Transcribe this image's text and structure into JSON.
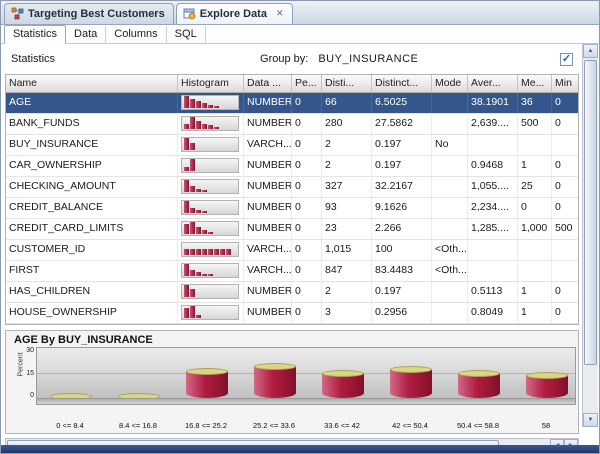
{
  "icons": {
    "check": "✓",
    "up": "▲",
    "down": "▼",
    "left": "◀",
    "right": "▶",
    "close": "✕"
  },
  "window_tabs": {
    "items": [
      {
        "label": "Targeting Best Customers",
        "active": false
      },
      {
        "label": "Explore Data",
        "active": true
      }
    ]
  },
  "subtabs": {
    "items": [
      "Statistics",
      "Data",
      "Columns",
      "SQL"
    ],
    "active": "Statistics"
  },
  "statistics_panel": {
    "title": "Statistics",
    "group_by_label": "Group by:",
    "group_by_value": "BUY_INSURANCE",
    "filter_checkbox_checked": true
  },
  "table": {
    "columns": [
      "Name",
      "Histogram",
      "Data ...",
      "Pe...",
      "Disti...",
      "Distinct...",
      "Mode",
      "Aver...",
      "Me...",
      "Min"
    ],
    "rows": [
      {
        "name": "AGE",
        "selected": true,
        "histogram": [
          1,
          0.75,
          0.55,
          0.4,
          0.28,
          0.18
        ],
        "data_type": "NUMBER",
        "percent_null": "0",
        "distinct_count": "66",
        "distinct_pct": "6.5025",
        "mode": "",
        "average": "38.1901",
        "median": "36",
        "min": "0"
      },
      {
        "name": "BANK_FUNDS",
        "selected": false,
        "histogram": [
          0.45,
          1,
          0.65,
          0.45,
          0.3,
          0.2
        ],
        "data_type": "NUMBER",
        "percent_null": "0",
        "distinct_count": "280",
        "distinct_pct": "27.5862",
        "mode": "",
        "average": "2,639....",
        "median": "500",
        "min": "0"
      },
      {
        "name": "BUY_INSURANCE",
        "selected": false,
        "histogram": [
          1,
          0.6
        ],
        "data_type": "VARCH...",
        "percent_null": "0",
        "distinct_count": "2",
        "distinct_pct": "0.197",
        "mode": "No",
        "average": "",
        "median": "",
        "min": ""
      },
      {
        "name": "CAR_OWNERSHIP",
        "selected": false,
        "histogram": [
          0.35,
          1
        ],
        "data_type": "NUMBER",
        "percent_null": "0",
        "distinct_count": "2",
        "distinct_pct": "0.197",
        "mode": "",
        "average": "0.9468",
        "median": "1",
        "min": "0"
      },
      {
        "name": "CHECKING_AMOUNT",
        "selected": false,
        "histogram": [
          1,
          0.5,
          0.28,
          0.16
        ],
        "data_type": "NUMBER",
        "percent_null": "0",
        "distinct_count": "327",
        "distinct_pct": "32.2167",
        "mode": "",
        "average": "1,055....",
        "median": "25",
        "min": "0"
      },
      {
        "name": "CREDIT_BALANCE",
        "selected": false,
        "histogram": [
          1,
          0.45,
          0.22,
          0.12
        ],
        "data_type": "NUMBER",
        "percent_null": "0",
        "distinct_count": "93",
        "distinct_pct": "9.1626",
        "mode": "",
        "average": "2,234....",
        "median": "0",
        "min": "0"
      },
      {
        "name": "CREDIT_CARD_LIMITS",
        "selected": false,
        "histogram": [
          0.85,
          1,
          0.55,
          0.3,
          0.18
        ],
        "data_type": "NUMBER",
        "percent_null": "0",
        "distinct_count": "23",
        "distinct_pct": "2.266",
        "mode": "",
        "average": "1,285....",
        "median": "1,000",
        "min": "500"
      },
      {
        "name": "CUSTOMER_ID",
        "selected": false,
        "histogram": [
          0.5,
          0.5,
          0.5,
          0.5,
          0.5,
          0.5,
          0.5,
          0.5
        ],
        "data_type": "VARCH...",
        "percent_null": "0",
        "distinct_count": "1,015",
        "distinct_pct": "100",
        "mode": "<Oth...",
        "average": "",
        "median": "",
        "min": ""
      },
      {
        "name": "FIRST",
        "selected": false,
        "histogram": [
          1,
          0.5,
          0.3,
          0.18,
          0.1
        ],
        "data_type": "VARCH...",
        "percent_null": "0",
        "distinct_count": "847",
        "distinct_pct": "83.4483",
        "mode": "<Oth...",
        "average": "",
        "median": "",
        "min": ""
      },
      {
        "name": "HAS_CHILDREN",
        "selected": false,
        "histogram": [
          1,
          0.65
        ],
        "data_type": "NUMBER",
        "percent_null": "0",
        "distinct_count": "2",
        "distinct_pct": "0.197",
        "mode": "",
        "average": "0.5113",
        "median": "1",
        "min": "0"
      },
      {
        "name": "HOUSE_OWNERSHIP",
        "selected": false,
        "histogram": [
          0.8,
          1,
          0.25
        ],
        "data_type": "NUMBER",
        "percent_null": "0",
        "distinct_count": "3",
        "distinct_pct": "0.2956",
        "mode": "",
        "average": "0.8049",
        "median": "1",
        "min": "0"
      }
    ]
  },
  "chart_data": {
    "type": "bar",
    "title": "AGE By BUY_INSURANCE",
    "ylabel": "Percent",
    "ylim": [
      0,
      30
    ],
    "yticks": [
      30,
      15,
      0
    ],
    "categories": [
      "0 <= 8.4",
      "8.4 <= 16.8",
      "16.8 <= 25.2",
      "25.2 <= 33.6",
      "33.6 <= 42",
      "42 <= 50.4",
      "50.4 <= 58.8",
      "58"
    ],
    "values": [
      1.2,
      0.8,
      16,
      19,
      15,
      17.5,
      15,
      14
    ],
    "bar_color": "#b01c41",
    "bar_cap_color": "#ddd583",
    "grid": true,
    "legend": false
  }
}
